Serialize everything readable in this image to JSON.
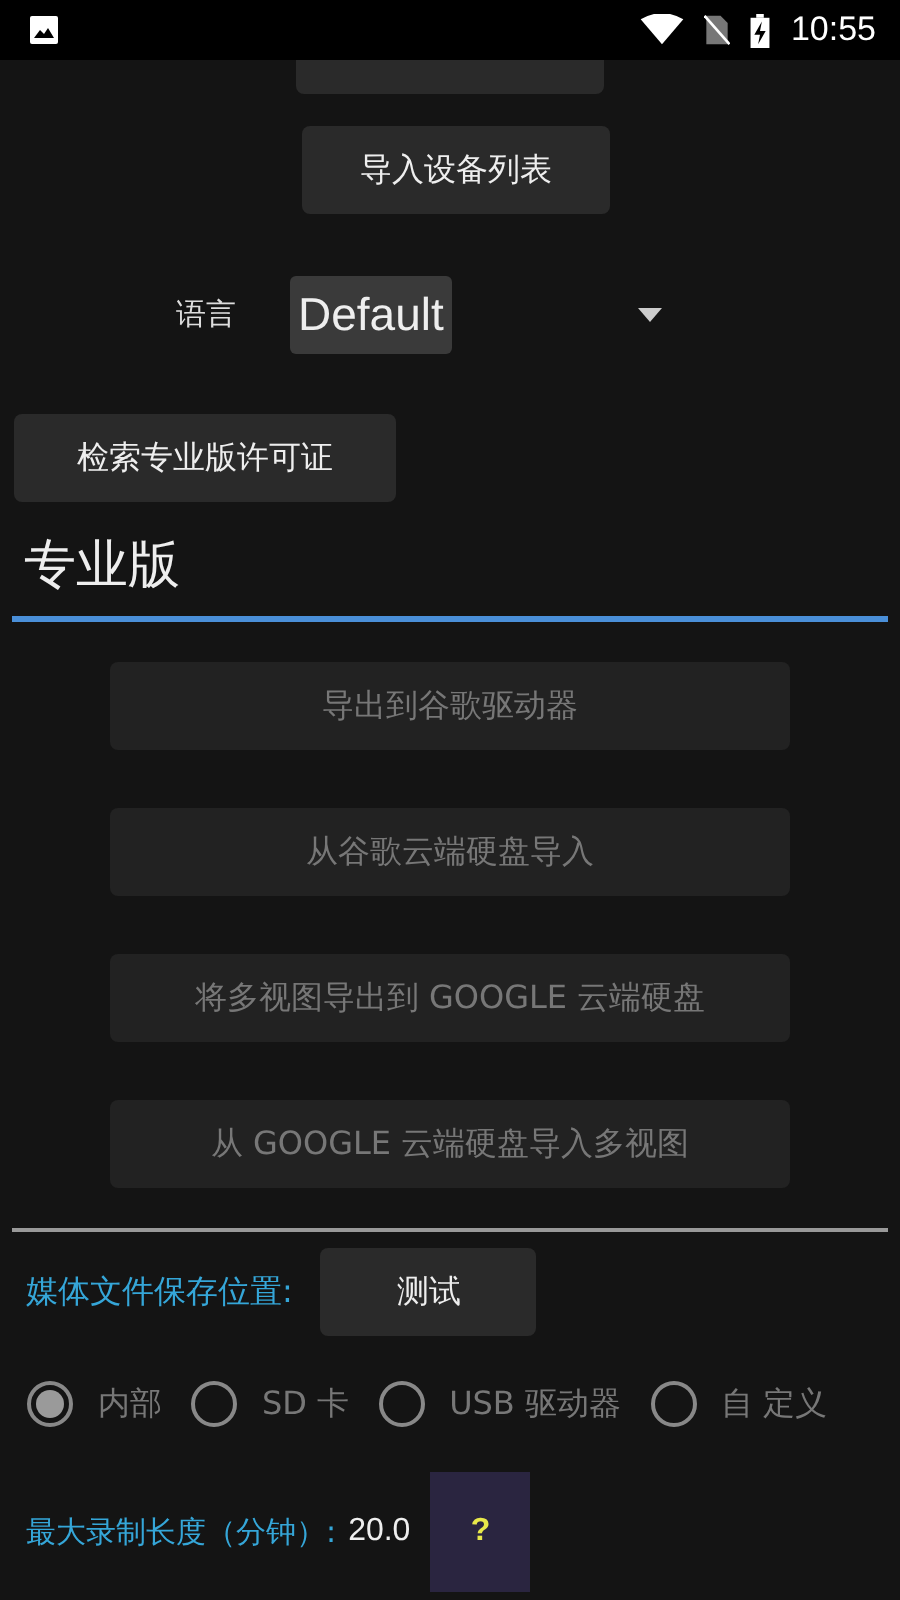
{
  "status_bar": {
    "time": "10:55"
  },
  "device_buttons": [
    {
      "label": "导入设备列表"
    }
  ],
  "language": {
    "label": "语言",
    "value": "Default"
  },
  "license_button": {
    "label": "检索专业版许可证"
  },
  "pro_section": {
    "title": "专业版"
  },
  "pro_buttons": [
    {
      "label": "导出到谷歌驱动器",
      "disabled": true
    },
    {
      "label": "从谷歌云端硬盘导入",
      "disabled": true
    },
    {
      "label": "将多视图导出到 GOOGLE 云端硬盘",
      "disabled": true
    },
    {
      "label": "从 GOOGLE 云端硬盘导入多视图",
      "disabled": true
    }
  ],
  "media_location": {
    "label": "媒体文件保存位置:",
    "test_button": "测试"
  },
  "storage_options": [
    {
      "label": "内部",
      "selected": true,
      "disabled": true
    },
    {
      "label": "SD 卡",
      "selected": false,
      "disabled": true
    },
    {
      "label": "USB 驱动器",
      "selected": false,
      "disabled": true
    },
    {
      "label": "自 定义",
      "selected": false,
      "disabled": true
    }
  ],
  "max_recording": {
    "label": "最大录制长度（分钟）:",
    "value": "20.0",
    "help": "?"
  }
}
